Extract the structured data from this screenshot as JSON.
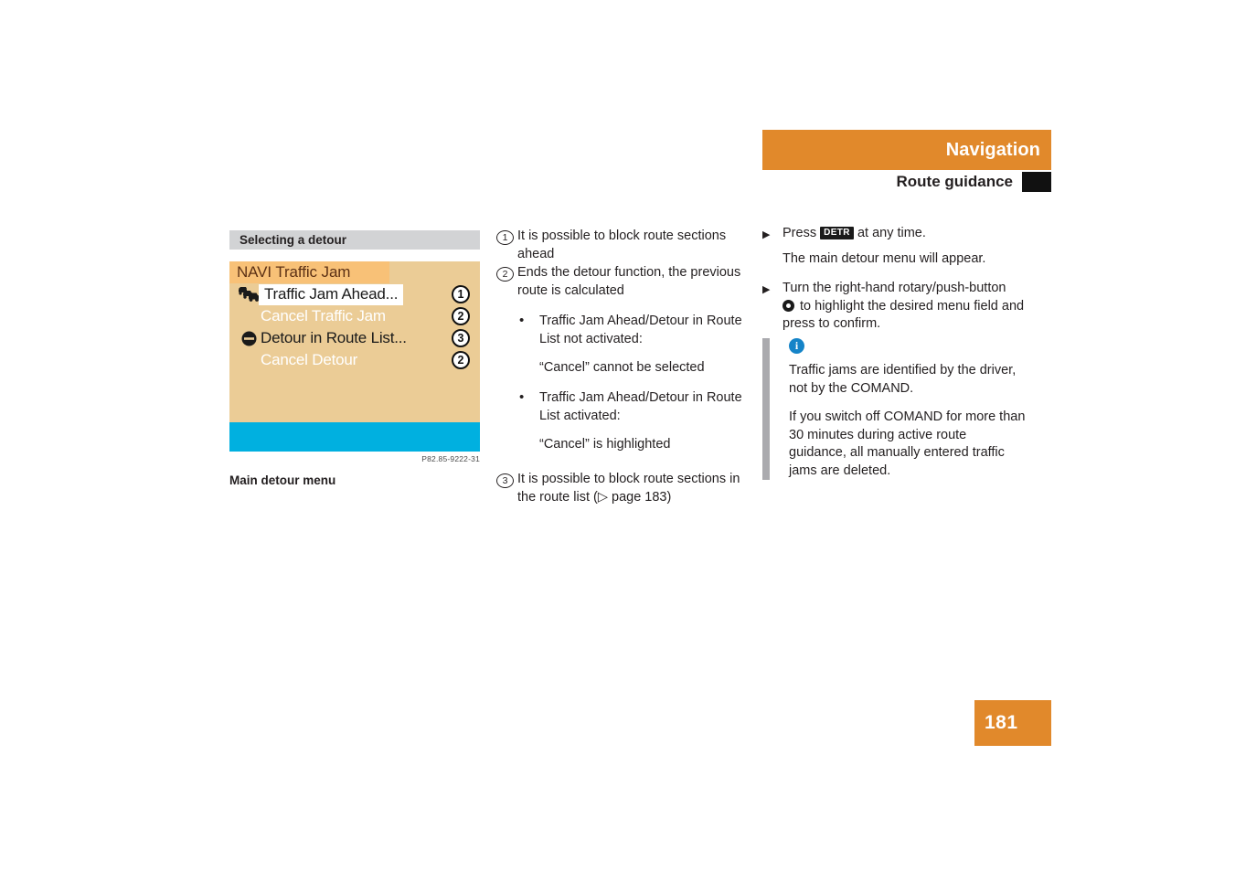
{
  "header": {
    "chapter_title": "Navigation",
    "section_title": "Route guidance",
    "accent_color": "#e1892b",
    "tab_color": "#111111"
  },
  "left_column": {
    "section_heading": "Selecting a detour",
    "navi_screen": {
      "title": "NAVI Traffic Jam",
      "title_bar_color": "#f8c177",
      "background_color": "#ebcc96",
      "status_bar_color": "#00b0e0",
      "rows": [
        {
          "icon": "traffic-jam-icon",
          "label": "Traffic Jam Ahead...",
          "state": "highlighted",
          "callout": "1"
        },
        {
          "icon": "",
          "label": "Cancel Traffic Jam",
          "state": "disabled",
          "callout": "2"
        },
        {
          "icon": "no-entry-icon",
          "label": "Detour in Route List...",
          "state": "enabled",
          "callout": "3"
        },
        {
          "icon": "",
          "label": "Cancel Detour",
          "state": "disabled",
          "callout": "2"
        }
      ]
    },
    "figure_id": "P82.85-9222-31",
    "figure_caption": "Main detour menu"
  },
  "middle_column": {
    "items": [
      {
        "marker": "1",
        "text": "It is possible to block route sections ahead"
      },
      {
        "marker": "2",
        "text": "Ends the detour function, the previous route is calculated"
      }
    ],
    "bullets": [
      {
        "dot": "•",
        "text": "Traffic Jam Ahead/Detour in Route List not activated:",
        "note": "“Cancel” cannot be selected"
      },
      {
        "dot": "•",
        "text": "Traffic Jam Ahead/Detour in Route List activated:",
        "note": "“Cancel” is highlighted"
      }
    ],
    "final_item": {
      "marker": "3",
      "text": "It is possible to block route sections in the route list (▷ page 183)"
    }
  },
  "right_column": {
    "step1": {
      "arrow": "▶",
      "text_before": "Press ",
      "key_label": "DETR",
      "text_after": " at any time.",
      "note": "The main detour menu will appear."
    },
    "step2": {
      "arrow": "▶",
      "line1": "Turn the right-hand rotary/push-button",
      "line2_after_icon": " to highlight the desired menu field and press to confirm."
    },
    "info_box": {
      "icon_label": "i",
      "icon_color": "#1584c8",
      "bar_color": "#aaaaae",
      "paragraphs": [
        "Traffic jams are identified by the driver, not by the COMAND.",
        "If you switch off COMAND for more than 30 minutes during active route guidance, all manually entered traffic jams are deleted."
      ]
    }
  },
  "footer": {
    "page_number": "181"
  }
}
